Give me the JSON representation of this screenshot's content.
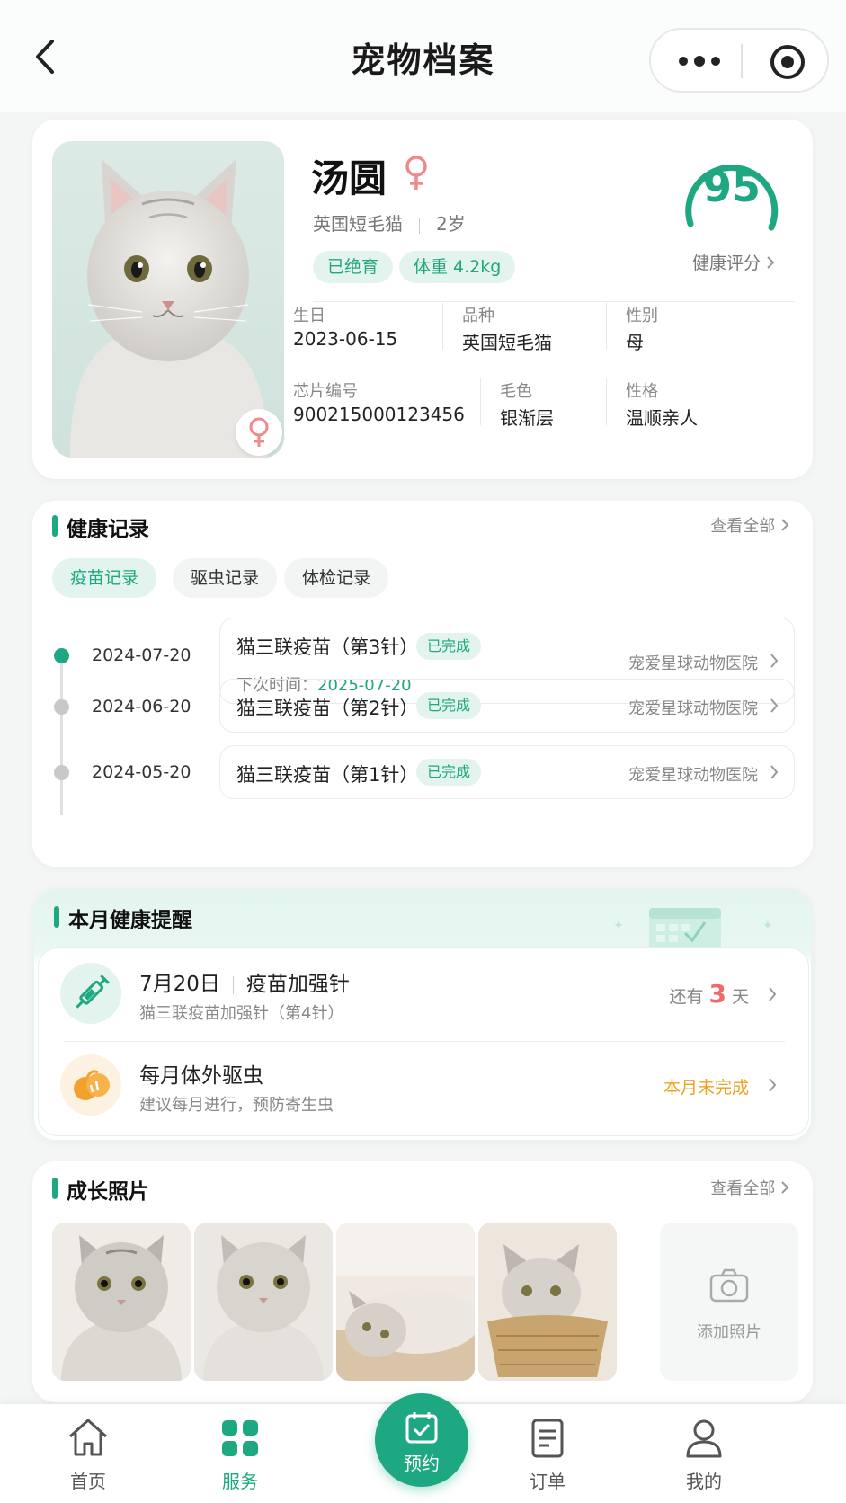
{
  "nav": {
    "title": "宠物档案"
  },
  "pet": {
    "name": "汤圆",
    "breed": "英国短毛猫",
    "age": "2岁",
    "tags": [
      "已绝育",
      "体重 4.2kg"
    ],
    "health_score": "95",
    "health_score_label": "健康评分",
    "info": [
      {
        "label": "生日",
        "value": "2023-06-15"
      },
      {
        "label": "品种",
        "value": "英国短毛猫"
      },
      {
        "label": "性别",
        "value": "母"
      },
      {
        "label": "芯片编号",
        "value": "900215000123456"
      },
      {
        "label": "毛色",
        "value": "银渐层"
      },
      {
        "label": "性格",
        "value": "温顺亲人"
      }
    ]
  },
  "health": {
    "title": "健康记录",
    "see_all": "查看全部",
    "tabs": [
      "疫苗记录",
      "驱虫记录",
      "体检记录"
    ],
    "records": [
      {
        "date": "2024-07-20",
        "name": "猫三联疫苗（第3针）",
        "status": "已完成",
        "next_label": "下次时间：",
        "next_date": "2025-07-20",
        "hospital": "宠爱星球动物医院"
      },
      {
        "date": "2024-06-20",
        "name": "猫三联疫苗（第2针）",
        "status": "已完成",
        "hospital": "宠爱星球动物医院"
      },
      {
        "date": "2024-05-20",
        "name": "猫三联疫苗（第1针）",
        "status": "已完成",
        "hospital": "宠爱星球动物医院"
      }
    ]
  },
  "reminder": {
    "title": "本月健康提醒",
    "items": [
      {
        "date": "7月20日",
        "title": "疫苗加强针",
        "desc": "猫三联疫苗加强针（第4针）",
        "right_pre": "还有",
        "right_num": "3",
        "right_post": "天"
      },
      {
        "title": "每月体外驱虫",
        "desc": "建议每月进行，预防寄生虫",
        "right": "本月未完成"
      }
    ]
  },
  "photos": {
    "title": "成长照片",
    "see_all": "查看全部",
    "add_label": "添加照片"
  },
  "tabbar": {
    "items": [
      "首页",
      "服务",
      "预约",
      "订单",
      "我的"
    ]
  },
  "colors": {
    "accent": "#1ea882",
    "warning": "#f0a020",
    "alert": "#f06a6a"
  }
}
